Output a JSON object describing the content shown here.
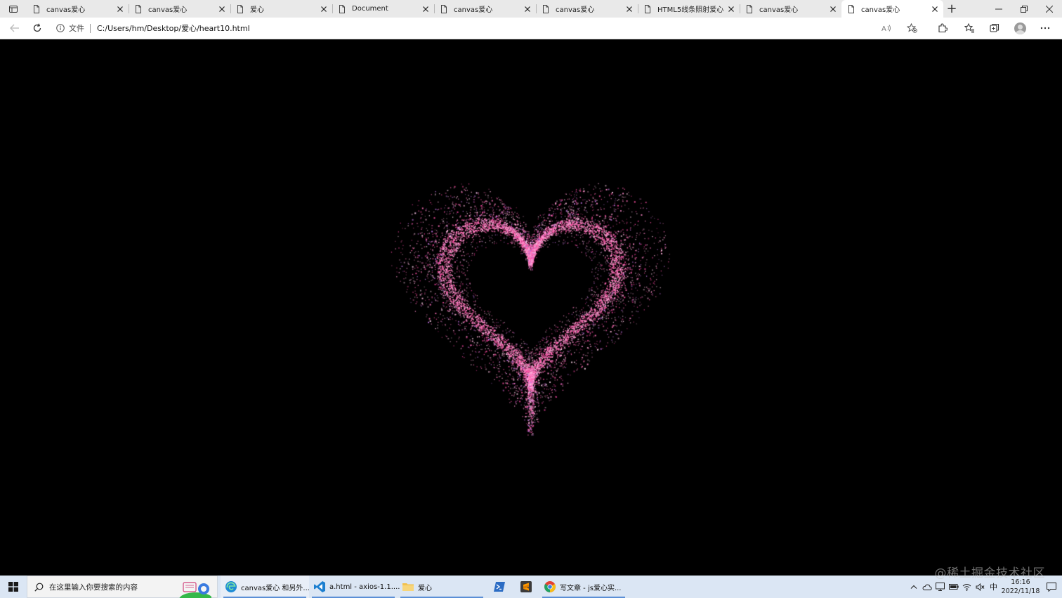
{
  "browser": {
    "tabs": [
      {
        "title": "canvas爱心",
        "icon": "page-icon",
        "active": false
      },
      {
        "title": "canvas爱心",
        "icon": "page-icon",
        "active": false
      },
      {
        "title": "爱心",
        "icon": "page-icon",
        "active": false
      },
      {
        "title": "Document",
        "icon": "page-icon",
        "active": false
      },
      {
        "title": "canvas爱心",
        "icon": "page-icon",
        "active": false
      },
      {
        "title": "canvas爱心",
        "icon": "page-icon",
        "active": false
      },
      {
        "title": "HTML5线条照射爱心",
        "icon": "page-icon",
        "active": false
      },
      {
        "title": "canvas爱心",
        "icon": "page-icon",
        "active": false
      },
      {
        "title": "canvas爱心",
        "icon": "page-icon",
        "active": true
      }
    ],
    "new_tab_label": "+",
    "address": {
      "site_info_label": "文件",
      "url": "C:/Users/hm/Desktop/爱心/heart10.html"
    }
  },
  "page": {
    "background": "#000000",
    "heart_color": "#ff5fb0",
    "heart_core_color": "#ff8ccc"
  },
  "taskbar": {
    "search_placeholder": "在这里输入你要搜索的内容",
    "items": [
      {
        "label": "canvas爱心 和另外...",
        "icon": "edge-icon",
        "running": true,
        "active": true
      },
      {
        "label": "a.html - axios-1.1....",
        "icon": "vscode-icon",
        "running": true,
        "active": false
      },
      {
        "label": "爱心",
        "icon": "folder-icon",
        "running": true,
        "active": false
      },
      {
        "label": "",
        "icon": "powershell-icon",
        "running": false,
        "active": false
      },
      {
        "label": "",
        "icon": "sublime-icon",
        "running": false,
        "active": false
      },
      {
        "label": "写文章 - js爱心实...",
        "icon": "chrome-icon",
        "running": true,
        "active": false
      }
    ],
    "tray": {
      "ime": "中",
      "time": "16:16",
      "date": "2022/11/18"
    }
  },
  "watermark": "@稀土掘金技术社区"
}
